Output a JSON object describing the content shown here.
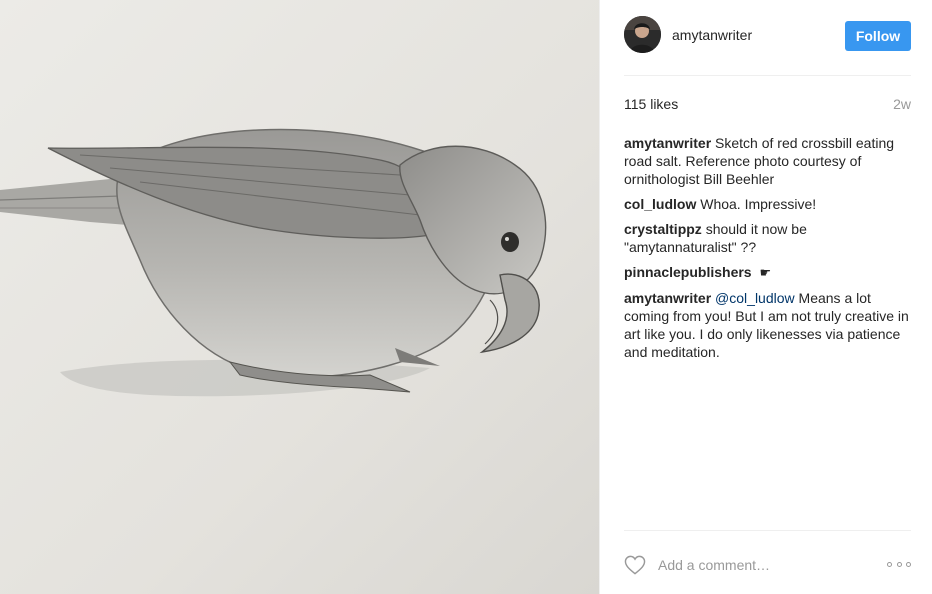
{
  "post": {
    "image_alt": "Pencil sketch of a red crossbill eating road salt",
    "username": "amytanwriter",
    "follow_label": "Follow",
    "likes": "115 likes",
    "time_ago": "2w"
  },
  "comments": [
    {
      "user": "amytanwriter",
      "text": "Sketch of red crossbill eating road salt. Reference photo courtesy of ornithologist Bill Beehler"
    },
    {
      "user": "col_ludlow",
      "text": "Whoa. Impressive!"
    },
    {
      "user": "crystaltippz",
      "text": "should it now be \"amytannaturalist\" ??"
    },
    {
      "user": "pinnaclepublishers",
      "icon": "pointing-hand-icon",
      "icon_glyph": "☛"
    },
    {
      "user": "amytanwriter",
      "mention": "@col_ludlow",
      "text": "Means a lot coming from you! But I am not truly creative in art like you. I do only likenesses via patience and meditation."
    }
  ],
  "footer": {
    "add_comment_placeholder": "Add a comment…",
    "like_icon": "heart-outline-icon",
    "more_icon": "ellipsis-icon"
  },
  "colors": {
    "follow_button": "#3897f0",
    "mention": "#003569",
    "muted": "#999999",
    "text": "#262626"
  }
}
